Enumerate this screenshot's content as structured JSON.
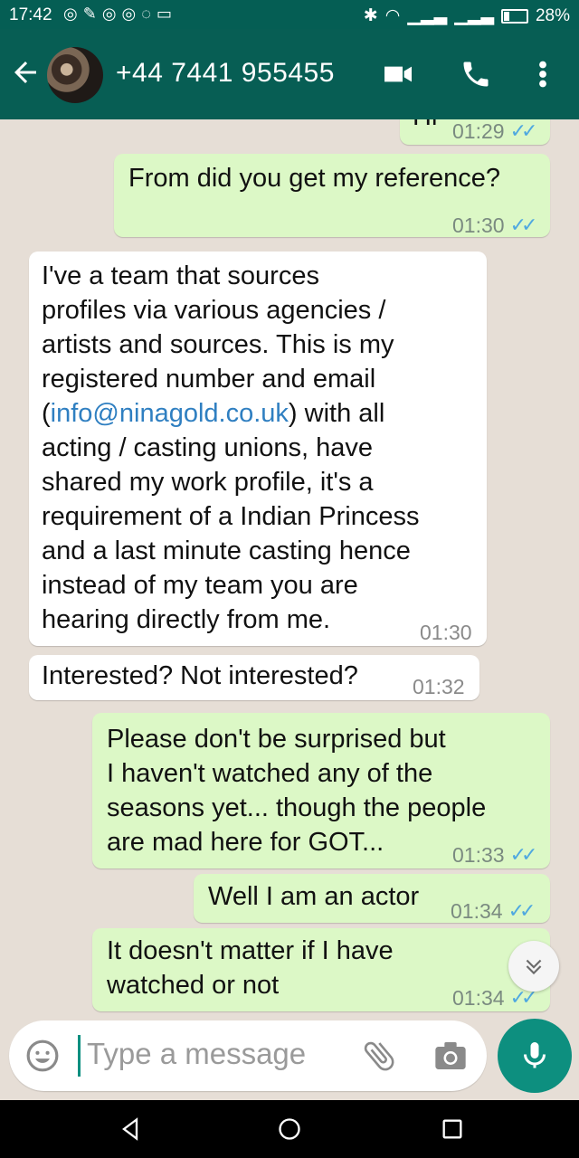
{
  "status_bar": {
    "time": "17:42",
    "battery": "28%"
  },
  "header": {
    "title": "+44 7441 955455"
  },
  "messages": [
    {
      "dir": "out",
      "text": "Hi",
      "time": "01:29",
      "ticks": true
    },
    {
      "dir": "out",
      "text": "From did you get my reference?",
      "time": "01:30",
      "ticks": true
    },
    {
      "dir": "in",
      "lines": [
        "I've a team that sources",
        "profiles via various agencies /",
        "artists and sources. This is my",
        "registered number and email"
      ],
      "line5_prefix": "(",
      "link": "info@ninagold.co.uk",
      "line5_suffix": ") with all",
      "lines_after": [
        "acting / casting unions, have",
        "shared my work profile, it's a",
        "requirement of a Indian Princess",
        "and a last minute casting hence",
        "instead of my team you are",
        "hearing directly from me."
      ],
      "time": "01:30"
    },
    {
      "dir": "in",
      "text": "Interested? Not interested?",
      "time": "01:32"
    },
    {
      "dir": "out",
      "lines": [
        "Please don't be surprised but",
        "I haven't watched any of the",
        "seasons yet... though the people",
        "are mad here for GOT..."
      ],
      "time": "01:33",
      "ticks": true
    },
    {
      "dir": "out",
      "text": "Well I am an actor",
      "time": "01:34",
      "ticks": true
    },
    {
      "dir": "out",
      "lines": [
        "It doesn't matter if I have",
        "watched or not"
      ],
      "time": "01:34",
      "ticks": true
    }
  ],
  "input": {
    "placeholder": "Type a message"
  },
  "icons": {
    "back": "arrow-left-icon",
    "video": "video-call-icon",
    "call": "phone-icon",
    "menu": "more-vert-icon",
    "emoji": "emoji-icon",
    "attach": "paperclip-icon",
    "camera": "camera-icon",
    "mic": "mic-icon",
    "scroll": "chevron-double-down-icon"
  },
  "colors": {
    "header": "#075e54",
    "outgoing": "#dcf8c6",
    "incoming": "#ffffff",
    "read_ticks": "#4fa8e0",
    "accent": "#0d8f7f"
  }
}
